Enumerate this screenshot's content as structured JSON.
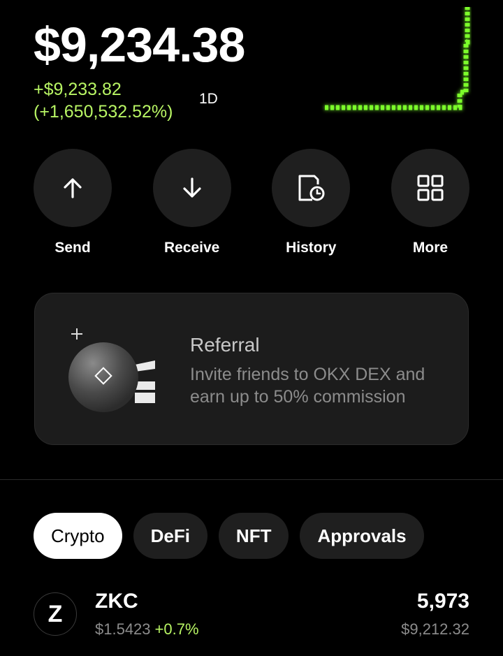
{
  "portfolio": {
    "balance": "$9,234.38",
    "change_amount": "+$9,233.82",
    "change_percent": "(+1,650,532.52%)",
    "period": "1D",
    "accent_color": "#b8f564",
    "sparkline_color": "#7cff2a"
  },
  "actions": [
    {
      "label": "Send",
      "icon": "arrow-up-icon"
    },
    {
      "label": "Receive",
      "icon": "arrow-down-icon"
    },
    {
      "label": "History",
      "icon": "history-icon"
    },
    {
      "label": "More",
      "icon": "grid-icon"
    }
  ],
  "referral": {
    "title": "Referral",
    "description": "Invite friends to OKX DEX and earn up to 50% commission",
    "icon": "referral-art-icon"
  },
  "tabs": [
    {
      "label": "Crypto",
      "active": true
    },
    {
      "label": "DeFi",
      "active": false
    },
    {
      "label": "NFT",
      "active": false
    },
    {
      "label": "Approvals",
      "active": false
    }
  ],
  "tokens": [
    {
      "icon_letter": "Z",
      "name": "ZKC",
      "price": "$1.5423",
      "change": "+0.7%",
      "amount": "5,973",
      "value": "$9,212.32"
    }
  ]
}
